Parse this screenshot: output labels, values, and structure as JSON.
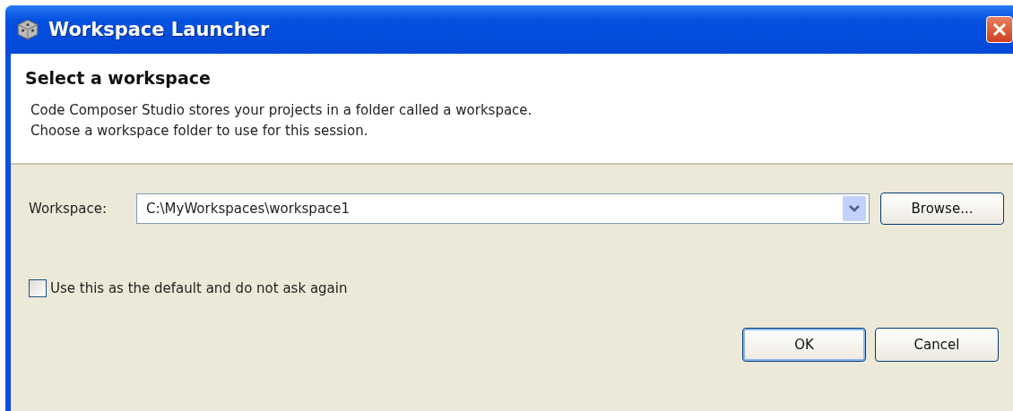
{
  "window": {
    "title": "Workspace Launcher"
  },
  "header": {
    "title": "Select a workspace",
    "description": [
      "Code Composer Studio stores your projects in a folder called a workspace.",
      "Choose a workspace folder to use for this session."
    ]
  },
  "workspace": {
    "label": "Workspace:",
    "value": "C:\\MyWorkspaces\\workspace1",
    "browse": "Browse..."
  },
  "remember": {
    "label": "Use this as the default and do not ask again",
    "checked": false
  },
  "buttons": [
    {
      "label": "OK",
      "default": true
    },
    {
      "label": "Cancel",
      "default": false
    }
  ]
}
